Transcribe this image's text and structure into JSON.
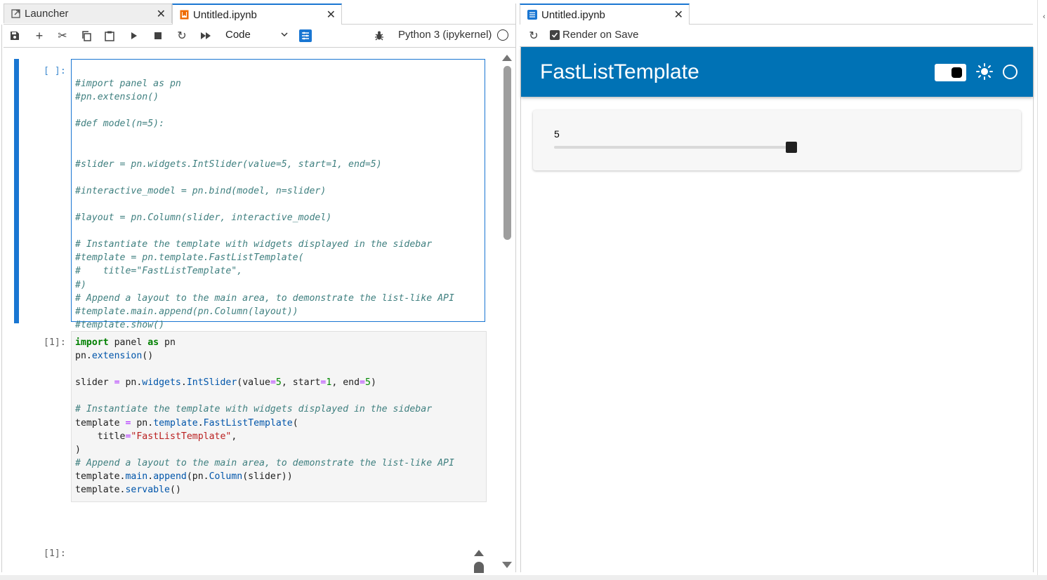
{
  "left_tabs": [
    {
      "label": "Launcher",
      "icon": "launcher-icon",
      "active": false
    },
    {
      "label": "Untitled.ipynb",
      "icon": "notebook-icon",
      "active": true
    }
  ],
  "toolbar": {
    "cell_type": "Code",
    "kernel_name": "Python 3 (ipykernel)"
  },
  "cells": [
    {
      "prompt": "[ ]:",
      "lines": [
        "#import panel as pn",
        "#pn.extension()",
        "",
        "#def model(n=5):",
        "",
        "",
        "#slider = pn.widgets.IntSlider(value=5, start=1, end=5)",
        "",
        "#interactive_model = pn.bind(model, n=slider)",
        "",
        "#layout = pn.Column(slider, interactive_model)",
        "",
        "# Instantiate the template with widgets displayed in the sidebar",
        "#template = pn.template.FastListTemplate(",
        "#    title=\"FastListTemplate\",",
        "#)",
        "# Append a layout to the main area, to demonstrate the list-like API",
        "#template.main.append(pn.Column(layout))",
        "#template.show()"
      ]
    },
    {
      "prompt": "[1]:",
      "lines": [
        "import panel as pn",
        "pn.extension()",
        "",
        "slider = pn.widgets.IntSlider(value=5, start=1, end=5)",
        "",
        "# Instantiate the template with widgets displayed in the sidebar",
        "template = pn.template.FastListTemplate(",
        "    title=\"FastListTemplate\",",
        ")",
        "# Append a layout to the main area, to demonstrate the list-like API",
        "template.main.append(pn.Column(slider))",
        "template.servable()"
      ]
    },
    {
      "prompt": "[1]:",
      "lines": []
    }
  ],
  "right_tab": {
    "label": "Untitled.ipynb",
    "icon": "preview-icon"
  },
  "preview_toolbar": {
    "render_on_save_label": "Render on Save",
    "render_on_save_checked": true
  },
  "preview": {
    "header_title": "FastListTemplate",
    "header_color": "#0072b5",
    "slider_value_label": "5",
    "slider": {
      "value": 5,
      "start": 1,
      "end": 5
    }
  }
}
